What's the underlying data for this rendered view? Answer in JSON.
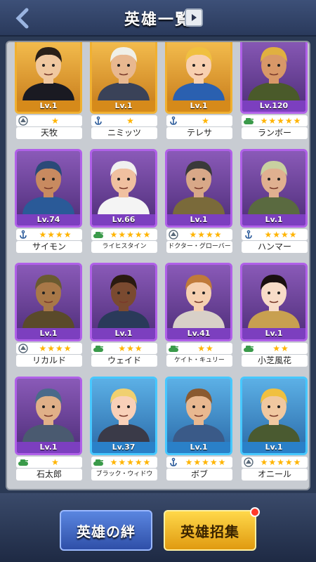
{
  "header": {
    "title": "英雄一覧"
  },
  "heroes": [
    {
      "name": "天牧",
      "level": "Lv.1",
      "stars": 1,
      "rarity": "gold",
      "class_icon": "fighter-emblem-icon",
      "skin": "#f0c8a0",
      "hair": "#2a2018",
      "outfit": "#1a1a22"
    },
    {
      "name": "ニミッツ",
      "level": "Lv.1",
      "stars": 1,
      "rarity": "gold",
      "class_icon": "anchor-icon",
      "skin": "#e8b890",
      "hair": "#f0f0e8",
      "outfit": "#3a4258"
    },
    {
      "name": "テレサ",
      "level": "Lv.1",
      "stars": 1,
      "rarity": "gold",
      "class_icon": "anchor-icon",
      "skin": "#f8d0b0",
      "hair": "#f0c040",
      "outfit": "#2a60b0"
    },
    {
      "name": "ランボー",
      "level": "Lv.120",
      "stars": 5,
      "rarity": "purple",
      "class_icon": "tank-icon",
      "skin": "#d89868",
      "hair": "#e0b040",
      "outfit": "#4a5a2a"
    },
    {
      "name": "サイモン",
      "level": "Lv.74",
      "stars": 4,
      "rarity": "purple",
      "class_icon": "anchor-icon",
      "skin": "#c88a60",
      "hair": "#2a4a78",
      "outfit": "#2a5a98"
    },
    {
      "name": "ライヒスタイン",
      "level": "Lv.66",
      "stars": 5,
      "rarity": "purple",
      "class_icon": "tank-icon",
      "skin": "#f0c0a0",
      "hair": "#f0f0f0",
      "outfit": "#f4f4f4"
    },
    {
      "name": "ドクター・グローバー",
      "level": "Lv.1",
      "stars": 4,
      "rarity": "purple",
      "class_icon": "fighter-emblem-icon",
      "skin": "#d8a888",
      "hair": "#3a3a3a",
      "outfit": "#7a6a3a"
    },
    {
      "name": "ハンマー",
      "level": "Lv.1",
      "stars": 4,
      "rarity": "purple",
      "class_icon": "anchor-icon",
      "skin": "#e0b090",
      "hair": "#c8d0a0",
      "outfit": "#5a6a40"
    },
    {
      "name": "リカルド",
      "level": "Lv.1",
      "stars": 4,
      "rarity": "purple",
      "class_icon": "fighter-emblem-icon",
      "skin": "#a87848",
      "hair": "#6a5a30",
      "outfit": "#5a4a2a"
    },
    {
      "name": "ウェイド",
      "level": "Lv.1",
      "stars": 3,
      "rarity": "purple",
      "class_icon": "tank-icon",
      "skin": "#7a4a30",
      "hair": "#2a1a10",
      "outfit": "#2a3a5a"
    },
    {
      "name": "ケイト・キュリー",
      "level": "Lv.41",
      "stars": 2,
      "rarity": "purple",
      "class_icon": "tank-icon",
      "skin": "#f6d0b0",
      "hair": "#c07a3a",
      "outfit": "#d8d0c8"
    },
    {
      "name": "小芝風花",
      "level": "Lv.1",
      "stars": 2,
      "rarity": "purple",
      "class_icon": "tank-icon",
      "skin": "#f8dcc8",
      "hair": "#1a1010",
      "outfit": "#c8a050"
    },
    {
      "name": "石太郎",
      "level": "Lv.1",
      "stars": 1,
      "rarity": "purple",
      "class_icon": "tank-icon",
      "skin": "#e0b088",
      "hair": "#4a6a8a",
      "outfit": "#4a5a70"
    },
    {
      "name": "ブラック・ウィドウ",
      "level": "Lv.37",
      "stars": 5,
      "rarity": "blue",
      "class_icon": "tank-icon",
      "skin": "#f8d0b8",
      "hair": "#f0d070",
      "outfit": "#3a3a48"
    },
    {
      "name": "ボブ",
      "level": "Lv.1",
      "stars": 5,
      "rarity": "blue",
      "class_icon": "anchor-icon",
      "skin": "#e8b890",
      "hair": "#8a5a30",
      "outfit": "#3a5a88"
    },
    {
      "name": "オニール",
      "level": "Lv.1",
      "stars": 5,
      "rarity": "blue",
      "class_icon": "fighter-emblem-icon",
      "skin": "#f0c8a0",
      "hair": "#f0c040",
      "outfit": "#4a5a30"
    }
  ],
  "footer": {
    "bond_label": "英雄の絆",
    "recruit_label": "英雄招集"
  }
}
